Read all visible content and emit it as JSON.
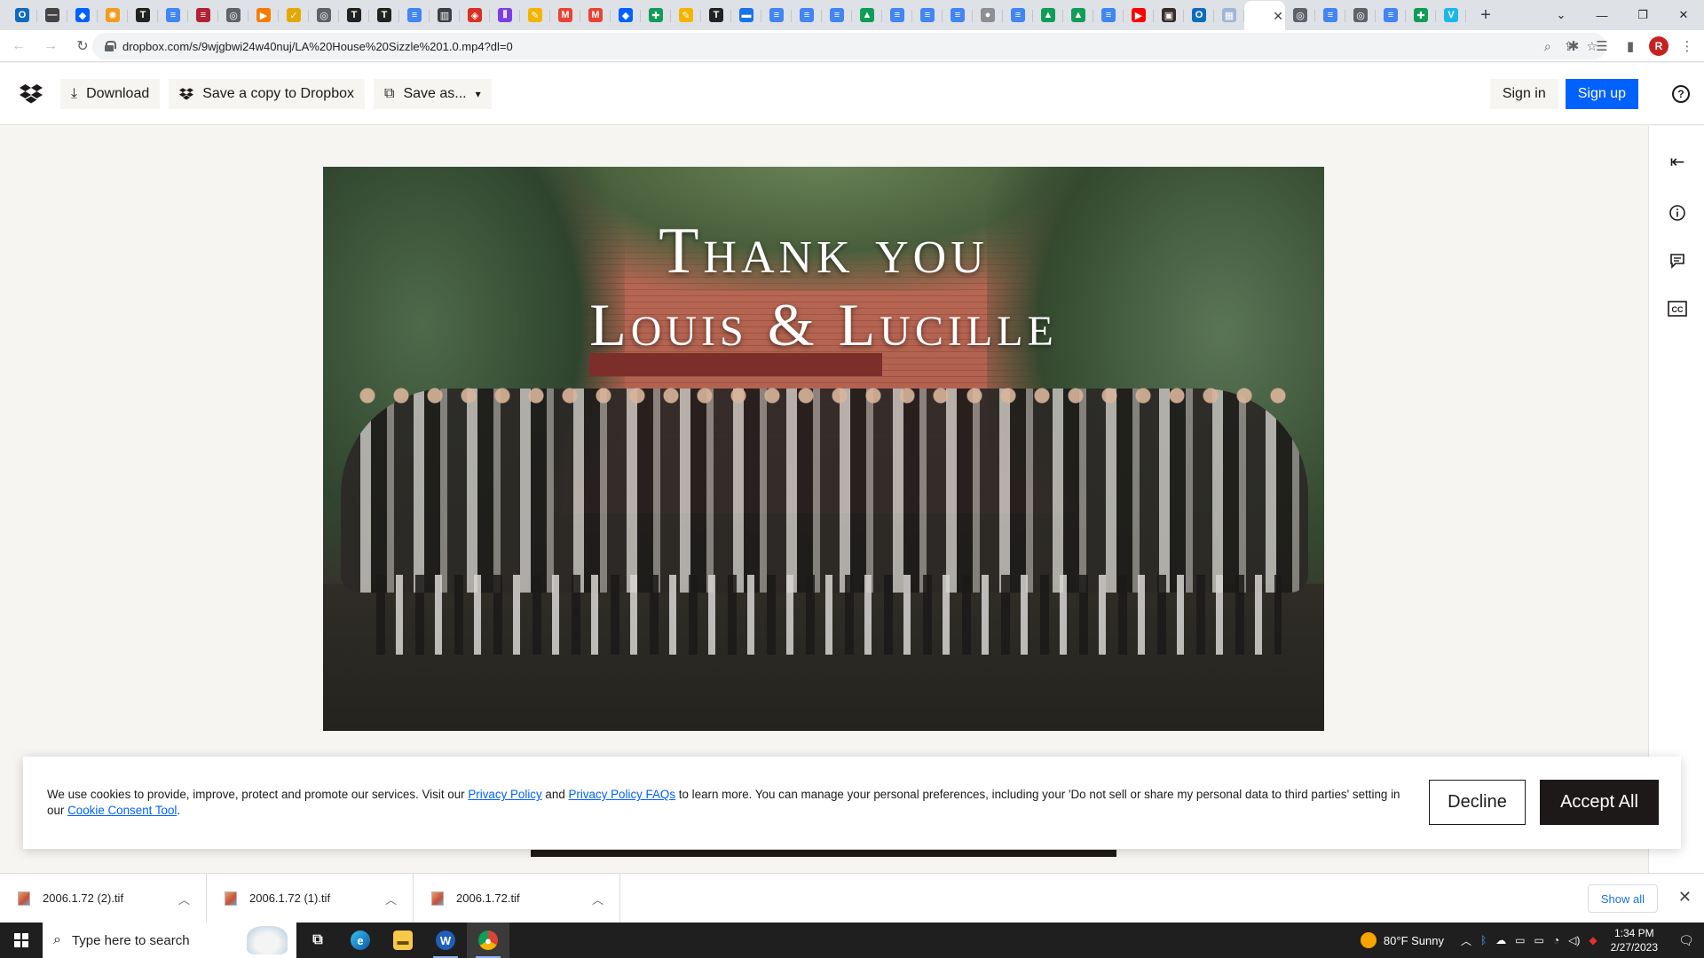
{
  "browser": {
    "tabs": [
      {
        "icon": "outlook-icon",
        "color": "#0f6cbd",
        "glyph": "O"
      },
      {
        "icon": "site-icon",
        "color": "#444444",
        "glyph": "—"
      },
      {
        "icon": "dropbox-icon",
        "color": "#0061fe",
        "glyph": "◆"
      },
      {
        "icon": "sun-icon",
        "color": "#f29c1f",
        "glyph": "✺"
      },
      {
        "icon": "nyt-icon",
        "color": "#222222",
        "glyph": "T"
      },
      {
        "icon": "docs-icon",
        "color": "#4285f4",
        "glyph": "≡"
      },
      {
        "icon": "flag-icon",
        "color": "#b22234",
        "glyph": "≡"
      },
      {
        "icon": "globe-icon",
        "color": "#5f6368",
        "glyph": "◎"
      },
      {
        "icon": "play-icon",
        "color": "#f57c00",
        "glyph": "▶"
      },
      {
        "icon": "bird-icon",
        "color": "#e4a900",
        "glyph": "✓"
      },
      {
        "icon": "globe-icon",
        "color": "#5f6368",
        "glyph": "◎"
      },
      {
        "icon": "nyt-icon",
        "color": "#222222",
        "glyph": "T"
      },
      {
        "icon": "nyt-icon",
        "color": "#222222",
        "glyph": "T"
      },
      {
        "icon": "docs-icon",
        "color": "#4285f4",
        "glyph": "≡"
      },
      {
        "icon": "book-icon",
        "color": "#3c4043",
        "glyph": "▥"
      },
      {
        "icon": "shield-icon",
        "color": "#d93025",
        "glyph": "◈"
      },
      {
        "icon": "podcast-icon",
        "color": "#7b3fe4",
        "glyph": "⦀"
      },
      {
        "icon": "pencil-icon",
        "color": "#f4b400",
        "glyph": "✎"
      },
      {
        "icon": "gmail-icon",
        "color": "#ea4335",
        "glyph": "M"
      },
      {
        "icon": "gmail-icon",
        "color": "#ea4335",
        "glyph": "M"
      },
      {
        "icon": "dropbox-icon",
        "color": "#0061fe",
        "glyph": "◆"
      },
      {
        "icon": "sheets-icon",
        "color": "#0f9d58",
        "glyph": "✚"
      },
      {
        "icon": "pencil-icon",
        "color": "#f4b400",
        "glyph": "✎"
      },
      {
        "icon": "nyt-icon",
        "color": "#222222",
        "glyph": "T"
      },
      {
        "icon": "site-icon",
        "color": "#1a73e8",
        "glyph": "▬"
      },
      {
        "icon": "docs-icon",
        "color": "#4285f4",
        "glyph": "≡"
      },
      {
        "icon": "docs-icon",
        "color": "#4285f4",
        "glyph": "≡"
      },
      {
        "icon": "docs-icon",
        "color": "#4285f4",
        "glyph": "≡"
      },
      {
        "icon": "drive-icon",
        "color": "#0f9d58",
        "glyph": "▲"
      },
      {
        "icon": "docs-icon",
        "color": "#4285f4",
        "glyph": "≡"
      },
      {
        "icon": "docs-icon",
        "color": "#4285f4",
        "glyph": "≡"
      },
      {
        "icon": "docs-icon",
        "color": "#4285f4",
        "glyph": "≡"
      },
      {
        "icon": "apple-icon",
        "color": "#8e8e93",
        "glyph": "●"
      },
      {
        "icon": "docs-icon",
        "color": "#4285f4",
        "glyph": "≡"
      },
      {
        "icon": "drive-icon",
        "color": "#0f9d58",
        "glyph": "▲"
      },
      {
        "icon": "drive-icon",
        "color": "#0f9d58",
        "glyph": "▲"
      },
      {
        "icon": "docs-icon",
        "color": "#4285f4",
        "glyph": "≡"
      },
      {
        "icon": "youtube-icon",
        "color": "#ff0000",
        "glyph": "▶"
      },
      {
        "icon": "video-icon",
        "color": "#3b2b28",
        "glyph": "▣"
      },
      {
        "icon": "outlook-icon",
        "color": "#0f6cbd",
        "glyph": "O"
      },
      {
        "icon": "image-icon",
        "color": "#9fb6d6",
        "glyph": "▦"
      }
    ],
    "active_tab": {
      "icon": "dropbox-icon",
      "close": "✕"
    },
    "tabs_after": [
      {
        "icon": "globe-icon",
        "color": "#5f6368",
        "glyph": "◎"
      },
      {
        "icon": "docs-icon",
        "color": "#4285f4",
        "glyph": "≡"
      },
      {
        "icon": "globe-icon",
        "color": "#5f6368",
        "glyph": "◎"
      },
      {
        "icon": "docs-icon",
        "color": "#4285f4",
        "glyph": "≡"
      },
      {
        "icon": "sheets-icon",
        "color": "#0f9d58",
        "glyph": "✚"
      },
      {
        "icon": "vimeo-icon",
        "color": "#1ab7ea",
        "glyph": "V"
      }
    ],
    "new_tab": "+",
    "url": "dropbox.com/s/9wjgbwi24w40nuj/LA%20House%20Sizzle%201.0.mp4?dl=0",
    "profile_initial": "R"
  },
  "header": {
    "download_label": "Download",
    "save_copy_label": "Save a copy to Dropbox",
    "save_as_label": "Save as...",
    "sign_in_label": "Sign in",
    "sign_up_label": "Sign up",
    "help_glyph": "?"
  },
  "video": {
    "title_line1": "Thank you",
    "title_line2": "Louis & Lucille"
  },
  "cookie": {
    "text_1": "We use cookies to provide, improve, protect and promote our services. Visit our ",
    "link_privacy": "Privacy Policy",
    "text_2": " and ",
    "link_faqs": "Privacy Policy FAQs",
    "text_3": " to learn more. You can manage your personal preferences, including your 'Do not sell or share my personal data to third parties' setting in our ",
    "link_consent": "Cookie Consent Tool",
    "text_4": ".",
    "decline_label": "Decline",
    "accept_label": "Accept All"
  },
  "downloads": {
    "items": [
      {
        "name": "2006.1.72 (2).tif"
      },
      {
        "name": "2006.1.72 (1).tif"
      },
      {
        "name": "2006.1.72.tif"
      }
    ],
    "show_all_label": "Show all"
  },
  "taskbar": {
    "search_placeholder": "Type here to search",
    "weather": "80°F  Sunny",
    "time": "1:34 PM",
    "date": "2/27/2023"
  },
  "colors": {
    "dropbox_blue": "#0061fe",
    "ink": "#1e1919",
    "canvas": "#f7f5f2"
  }
}
